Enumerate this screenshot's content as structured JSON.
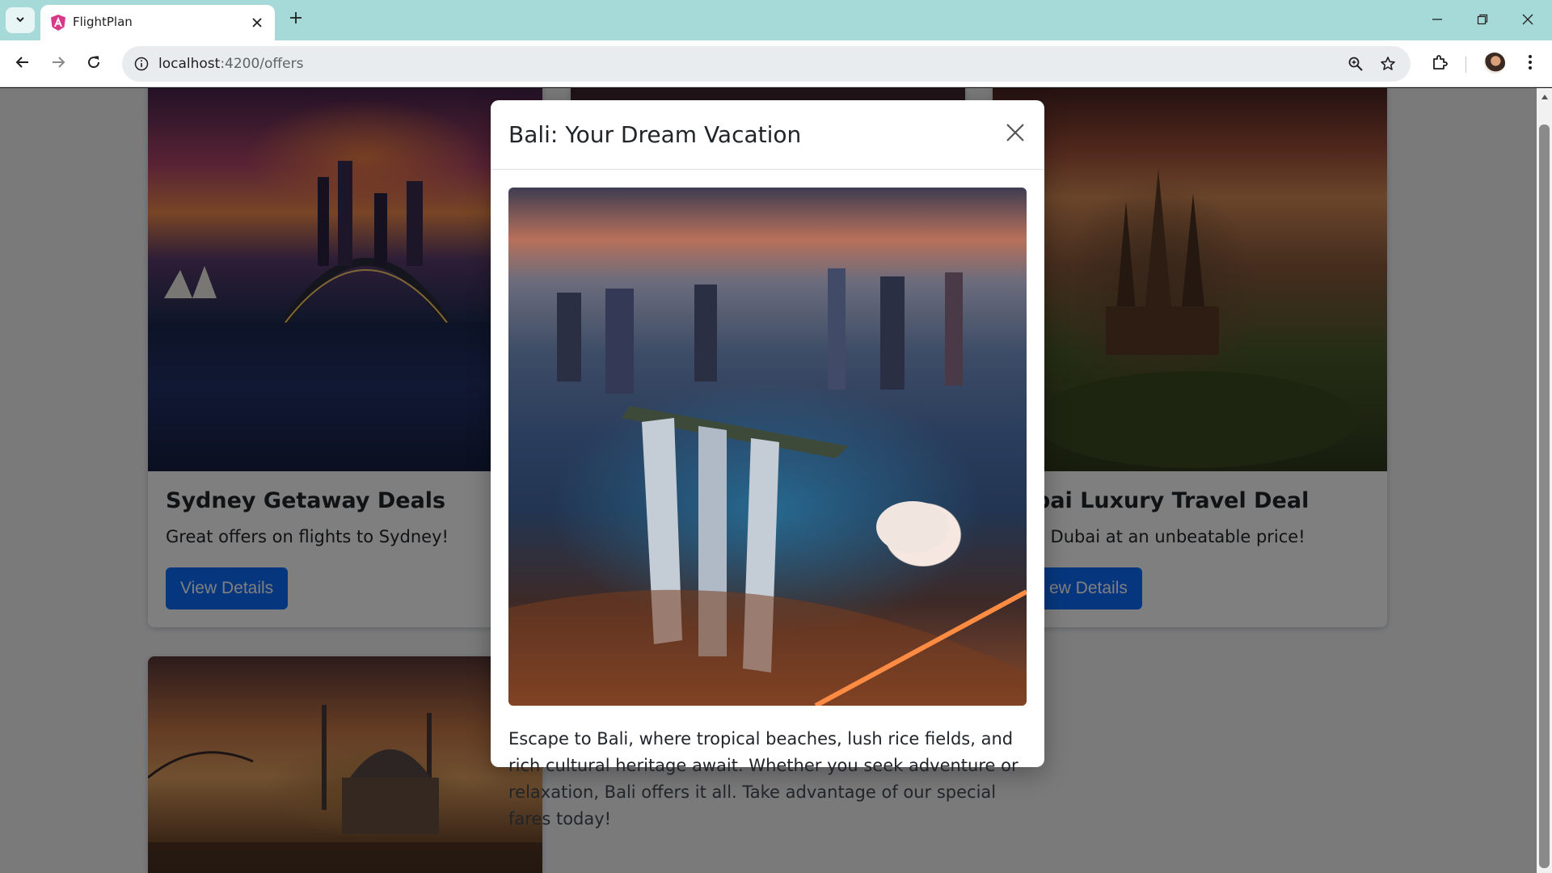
{
  "browser": {
    "tab_title": "FlightPlan",
    "url_host": "localhost",
    "url_path": ":4200/offers"
  },
  "page": {
    "cards": [
      {
        "title": "Sydney Getaway Deals",
        "text": "Great offers on flights to Sydney!",
        "button": "View Details"
      },
      {
        "title": "bai Luxury Travel Deal",
        "text": "o Dubai at an unbeatable price!",
        "button": "ew Details"
      }
    ]
  },
  "modal": {
    "title": "Bali: Your Dream Vacation",
    "description": "Escape to Bali, where tropical beaches, lush rice fields, and rich cultural heritage await. Whether you seek adventure or relaxation, Bali offers it all. Take advantage of our special fares today!"
  },
  "icons": {
    "tab_search": "chevron-down-icon",
    "favicon": "angular-icon",
    "tab_close": "close-icon",
    "new_tab": "plus-icon",
    "back": "back-arrow-icon",
    "forward": "forward-arrow-icon",
    "reload": "reload-icon",
    "site_info": "info-icon",
    "zoom": "zoom-icon",
    "bookmark": "star-icon",
    "extensions": "puzzle-icon",
    "menu": "kebab-menu-icon"
  },
  "colors": {
    "primary_button": "#0d6efd",
    "tabstrip": "#a6dad9",
    "backdrop": "rgba(0,0,0,0.5)"
  }
}
